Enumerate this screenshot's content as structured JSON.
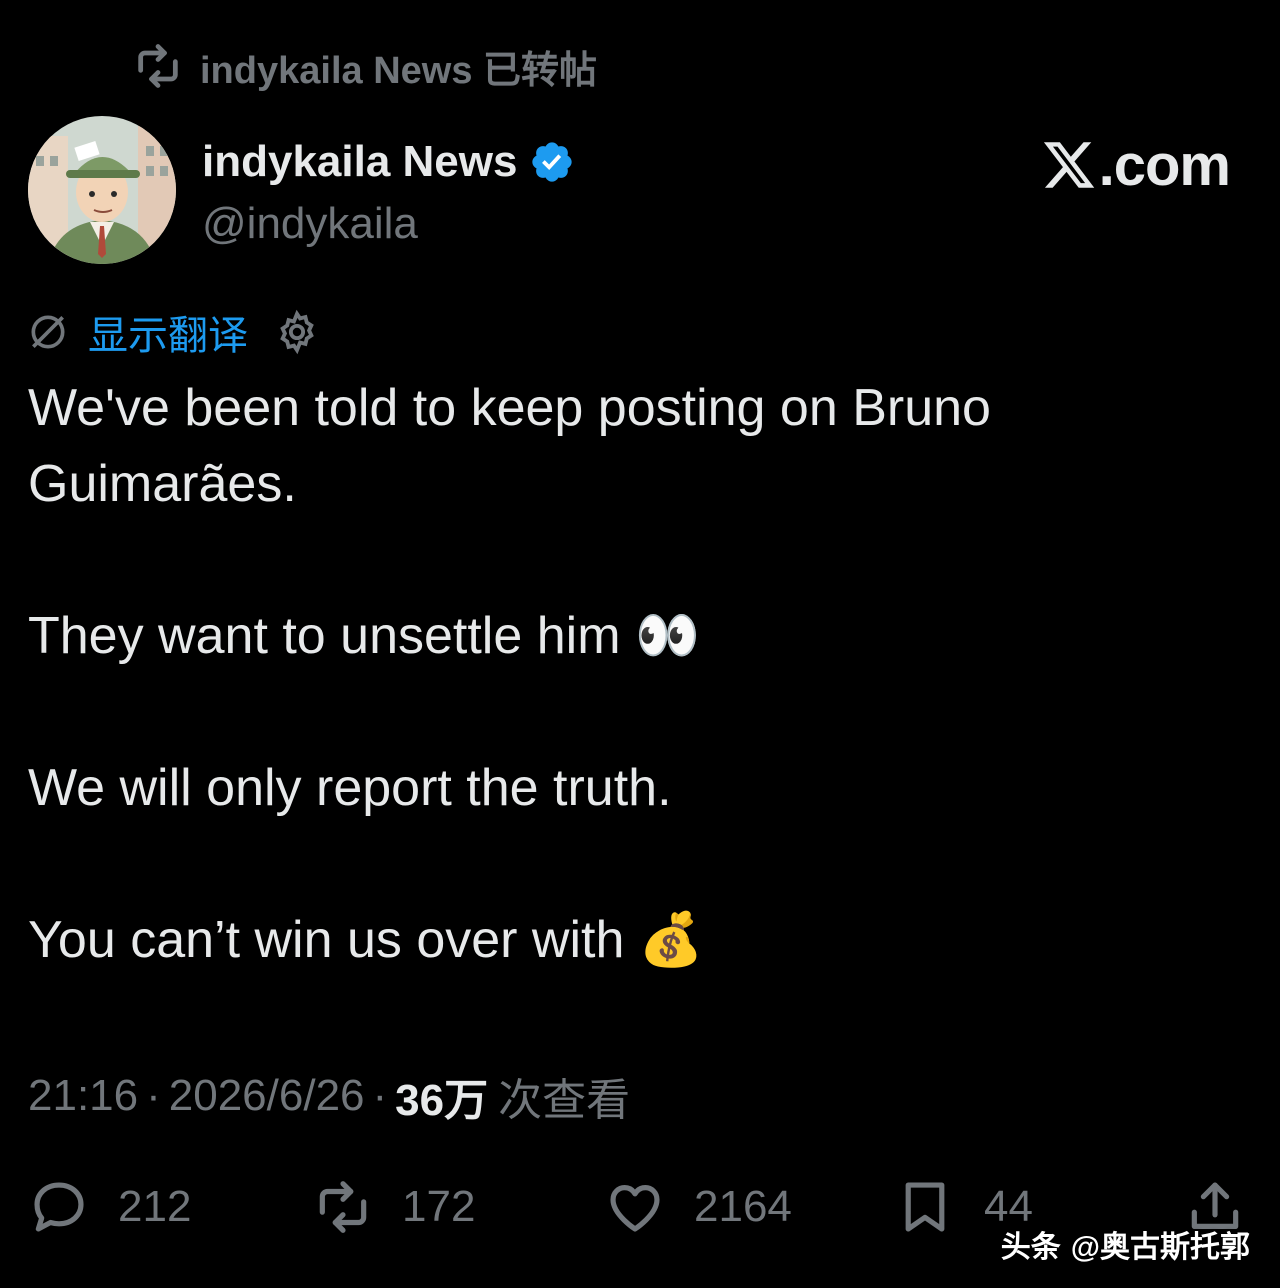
{
  "repost": {
    "text": "indykaila News 已转帖"
  },
  "author": {
    "display_name": "indykaila News",
    "handle": "@indykaila",
    "verified": true,
    "avatar_icon": "cartoon-reporter-avatar"
  },
  "site_mark": {
    "text": ".com",
    "logo_icon": "x-logo-icon"
  },
  "translate": {
    "label": "显示翻译",
    "globe_icon": "globe-icon",
    "settings_icon": "gear-icon"
  },
  "tweet": {
    "lines": [
      "We've been told to keep posting on Bruno",
      "Guimarães.",
      "They want to unsettle him 👀",
      "We will only report the truth.",
      "You can’t win us over with 💰"
    ]
  },
  "meta": {
    "time": "21:16",
    "separator": "·",
    "date": "2026/6/26",
    "views_count": "36万",
    "views_label": "次查看"
  },
  "actions": {
    "reply_count": "212",
    "repost_count": "172",
    "like_count": "2164",
    "bookmark_count": "44"
  },
  "watermark": {
    "brand": "头条",
    "account": "@奥古斯托郭"
  },
  "colors": {
    "background": "#000000",
    "text": "#e7e9ea",
    "muted": "#71767b",
    "accent": "#1d9bf0"
  }
}
